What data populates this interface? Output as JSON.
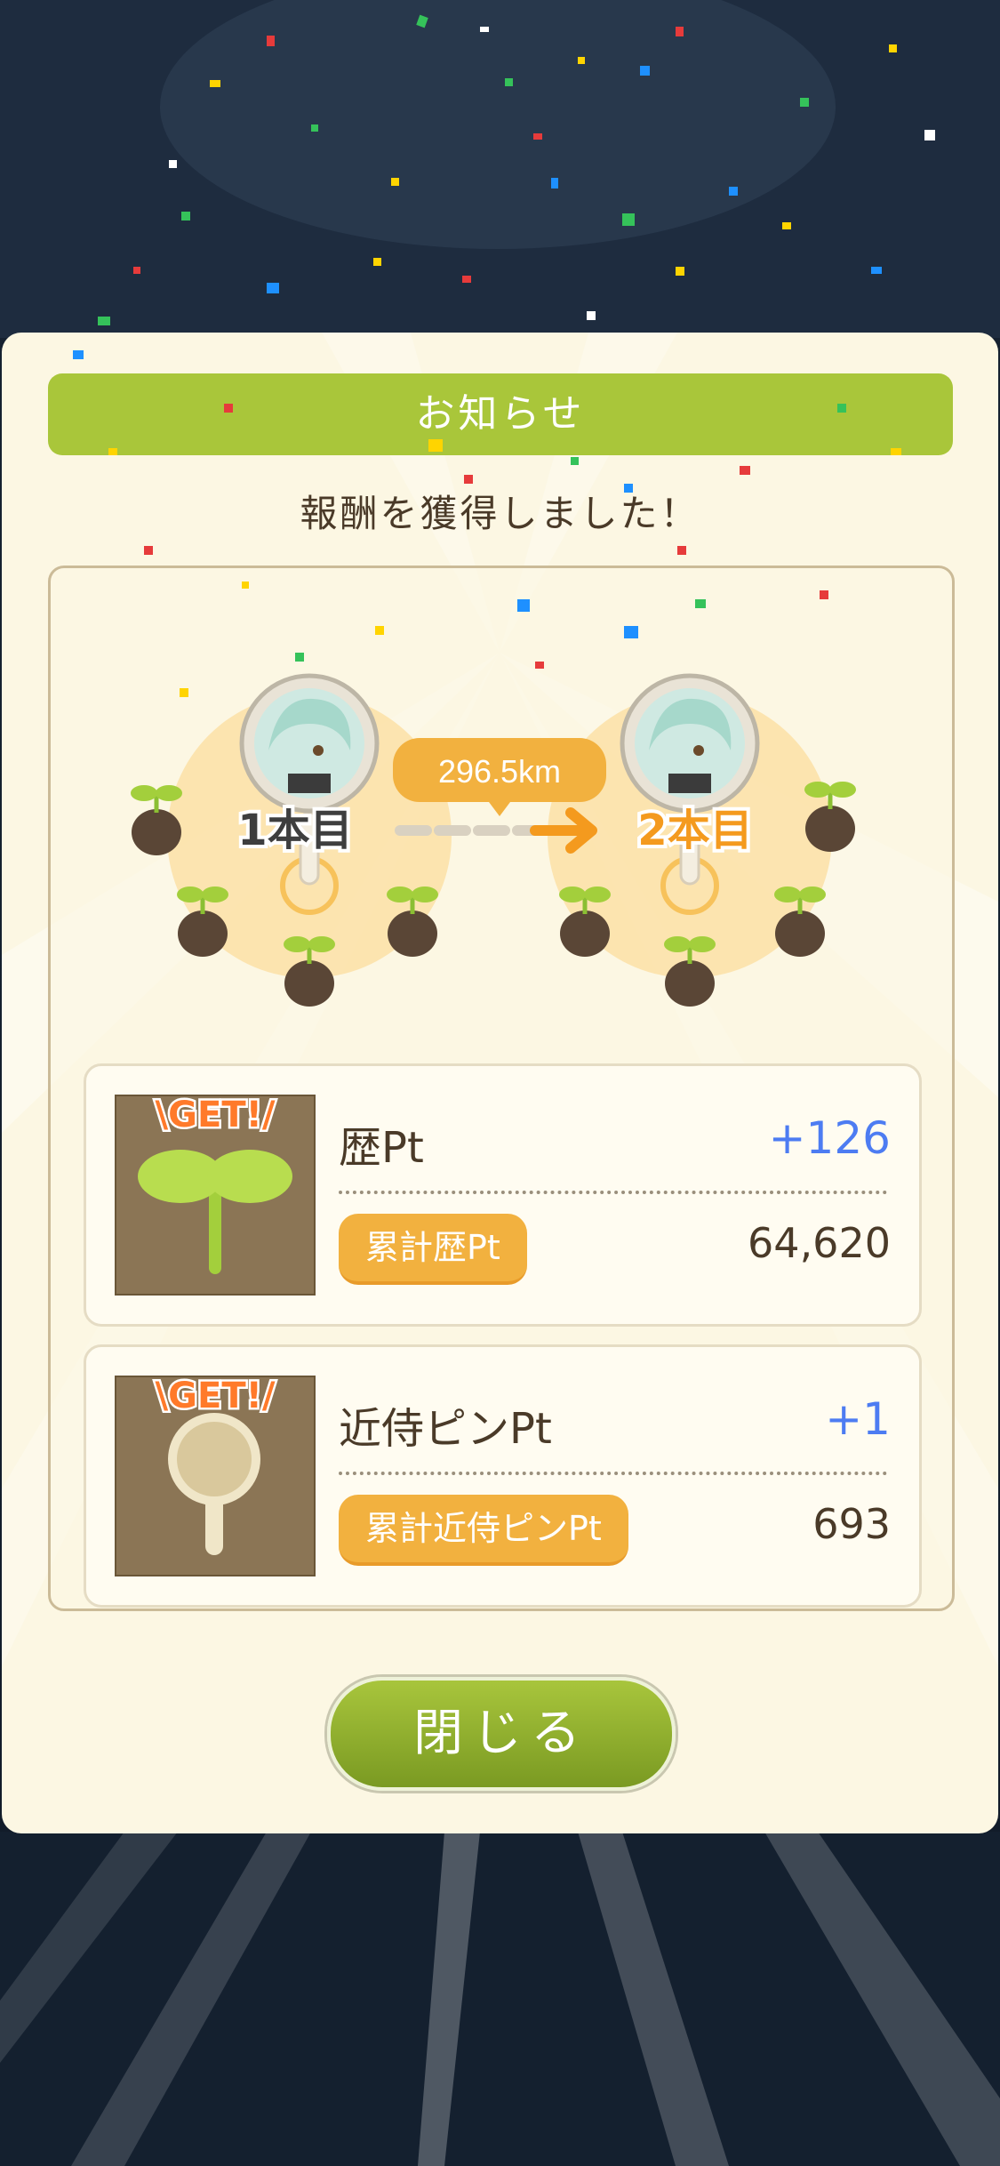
{
  "dialog": {
    "title": "お知らせ",
    "message": "報酬を獲得しました！"
  },
  "route": {
    "from_label": "1本目",
    "to_label": "2本目",
    "distance": "296.5km"
  },
  "rewards": [
    {
      "badge": "\\GET!/",
      "label": "歴Pt",
      "gain": "+126",
      "total_label": "累計歴Pt",
      "total_value": "64,620",
      "icon": "sprout-icon"
    },
    {
      "badge": "\\GET!/",
      "label": "近侍ピンPt",
      "gain": "+1",
      "total_label": "累計近侍ピンPt",
      "total_value": "693",
      "icon": "pin-icon"
    }
  ],
  "close_label": "閉じる",
  "colors": {
    "title_bar": "#a9c63a",
    "accent_orange": "#f2b13f",
    "gain_blue": "#4d7cf2",
    "panel_bg": "#fcf7e3"
  }
}
